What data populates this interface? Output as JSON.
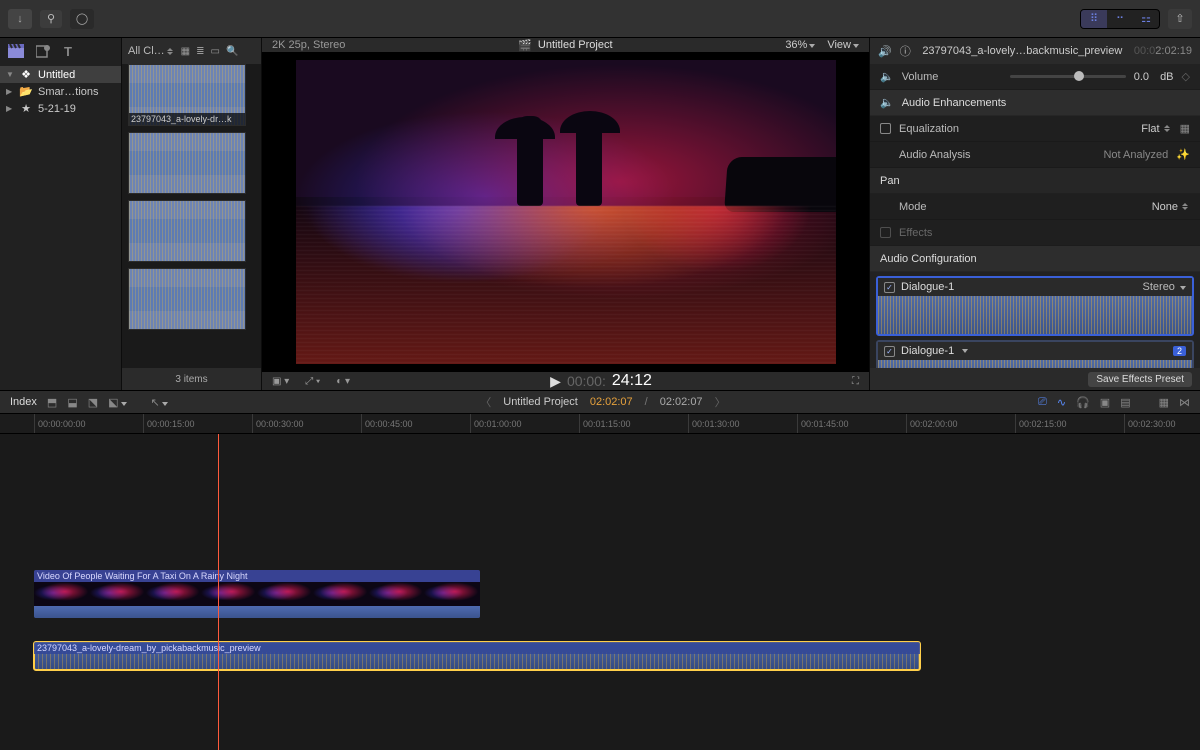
{
  "topbar": {
    "import_icon": "↓",
    "key_icon": "⚿",
    "bg_icon": "◧"
  },
  "library": {
    "tab_clip": "clip",
    "tab_photo": "photo",
    "tab_title": "title",
    "items": [
      {
        "name": "Untitled",
        "icon": "★",
        "selected": true
      },
      {
        "name": "Smar…tions",
        "icon": "📁"
      },
      {
        "name": "5-21-19",
        "icon": "★"
      }
    ]
  },
  "browser": {
    "dropdown": "All Cl…",
    "clip_caption": "23797043_a-lovely-dr…k",
    "footer_count": "3 items"
  },
  "viewer": {
    "format_info": "2K 25p, Stereo",
    "project_title": "Untitled Project",
    "zoom": "36%",
    "view_menu": "View",
    "time_dim": "00:00:",
    "time_big": "24:12"
  },
  "inspector": {
    "icon_audio": "🔊",
    "icon_info": "ⓘ",
    "clip_name": "23797043_a-lovely…backmusic_preview",
    "clip_dur_dim": "00:0",
    "clip_dur": "2:02:19",
    "volume_label": "Volume",
    "volume_value": "0.0",
    "volume_unit": "dB",
    "sec_enhance": "Audio Enhancements",
    "eq_label": "Equalization",
    "eq_value": "Flat",
    "analysis_label": "Audio Analysis",
    "analysis_value": "Not Analyzed",
    "pan_header": "Pan",
    "pan_mode_label": "Mode",
    "pan_mode_value": "None",
    "effects_label": "Effects",
    "sec_config": "Audio Configuration",
    "comp1_name": "Dialogue-1",
    "comp1_role": "Stereo",
    "comp2_name": "Dialogue-1",
    "comp2_badge": "2",
    "save_preset": "Save Effects Preset"
  },
  "tlbar": {
    "index": "Index",
    "project": "Untitled Project",
    "tc_current": "02:02:07",
    "tc_duration": "02:02:07"
  },
  "ruler_labels": [
    "00:00:00:00",
    "00:00:15:00",
    "00:00:30:00",
    "00:00:45:00",
    "00:01:00:00",
    "00:01:15:00",
    "00:01:30:00",
    "00:01:45:00",
    "00:02:00:00",
    "00:02:15:00",
    "00:02:30:00"
  ],
  "clips": {
    "video_name": "Video Of People Waiting For A Taxi On A Rainy Night",
    "audio_name": "23797043_a-lovely-dream_by_pickabackmusic_preview"
  }
}
